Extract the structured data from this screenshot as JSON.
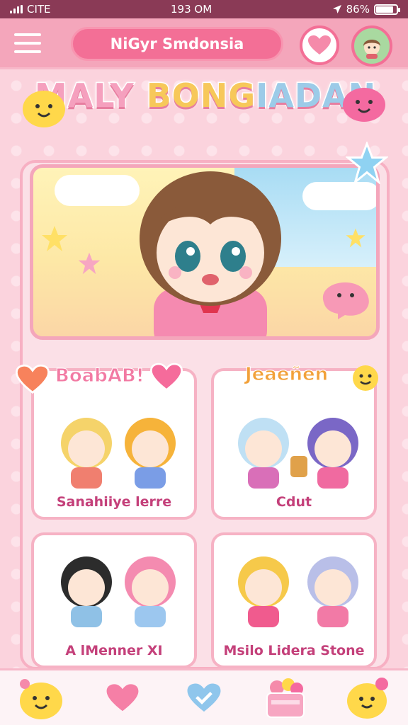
{
  "status_bar": {
    "carrier": "CITE",
    "time": "193 OM",
    "battery": "86%",
    "battery_level": 0.86
  },
  "top_bar": {
    "search_text": "NiGyr Smdonsia"
  },
  "banner": {
    "title_part1": "MALY ",
    "title_part2": "BONG",
    "title_part3": "IADAN"
  },
  "cards": [
    {
      "tag": "BoabAB!",
      "label": "Sanahiiye lerre"
    },
    {
      "tag": "Jeaeñen",
      "label": "Cdut"
    },
    {
      "tag": "",
      "label": "A lMenner XI"
    },
    {
      "tag": "",
      "label": "Msilo Lidera Stone"
    }
  ],
  "colors": {
    "accent": "#f36f96",
    "status_bar": "#8a3a56",
    "top_bar": "#f4a6bb",
    "card_border": "#f6b2c4",
    "label_text": "#c4407a"
  },
  "icons": {
    "menu": "hamburger-icon",
    "favorite": "heart-icon",
    "profile": "avatar",
    "nav_home": "blob-mascot-icon",
    "nav_favorites": "heart-icon",
    "nav_check": "heart-check-icon",
    "nav_shop": "basket-icon",
    "nav_mascot": "yellow-mascot-icon"
  }
}
